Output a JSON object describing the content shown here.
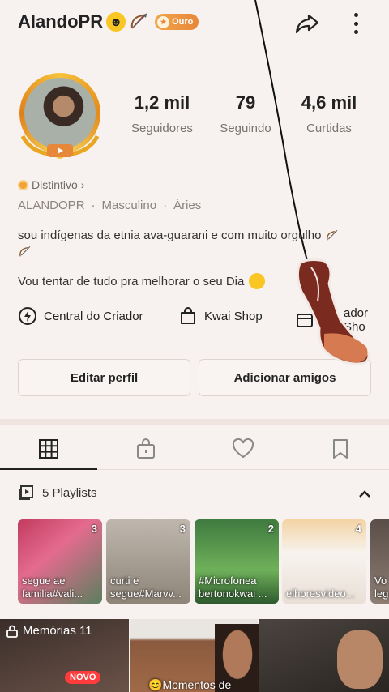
{
  "header": {
    "username": "AlandoPR",
    "level_badge": "Ouro"
  },
  "stats": [
    {
      "value": "1,2 mil",
      "label": "Seguidores"
    },
    {
      "value": "79",
      "label": "Seguindo"
    },
    {
      "value": "4,6 mil",
      "label": "Curtidas"
    }
  ],
  "profile": {
    "distintivo": "Distintivo",
    "handle": "ALANDOPR",
    "gender": "Masculino",
    "sign": "Áries",
    "bio_line1": "sou indígenas da etnia ava-guarani e com muito orgulho",
    "bio_line2": "Vou tentar de tudo pra melhorar o seu Dia"
  },
  "tools": {
    "creator_center": "Central do Criador",
    "kwai_shop": "Kwai Shop",
    "creator_shop": "ador Sho"
  },
  "actions": {
    "edit_profile": "Editar perfil",
    "add_friends": "Adicionar amigos"
  },
  "tabs": [
    "grid-icon",
    "lock-bag-icon",
    "heart-icon",
    "bookmark-icon"
  ],
  "playlists": {
    "header": "5 Playlists",
    "items": [
      {
        "count": "3",
        "title": "segue ae familia#vali..."
      },
      {
        "count": "3",
        "title": "curti e segue#Marvv..."
      },
      {
        "count": "2",
        "title": "#Microfonea bertonokwai ..."
      },
      {
        "count": "4",
        "title": "elhoresvideo..."
      },
      {
        "count": "",
        "title": "Vo leg"
      }
    ]
  },
  "memories": {
    "label": "Memórias 11",
    "new_badge": "NOVO"
  },
  "videos": {
    "caption": "Momentos de"
  },
  "colors": {
    "accent": "#e7873a",
    "background": "#f7f1ef",
    "new_badge": "#ff3b3b"
  }
}
